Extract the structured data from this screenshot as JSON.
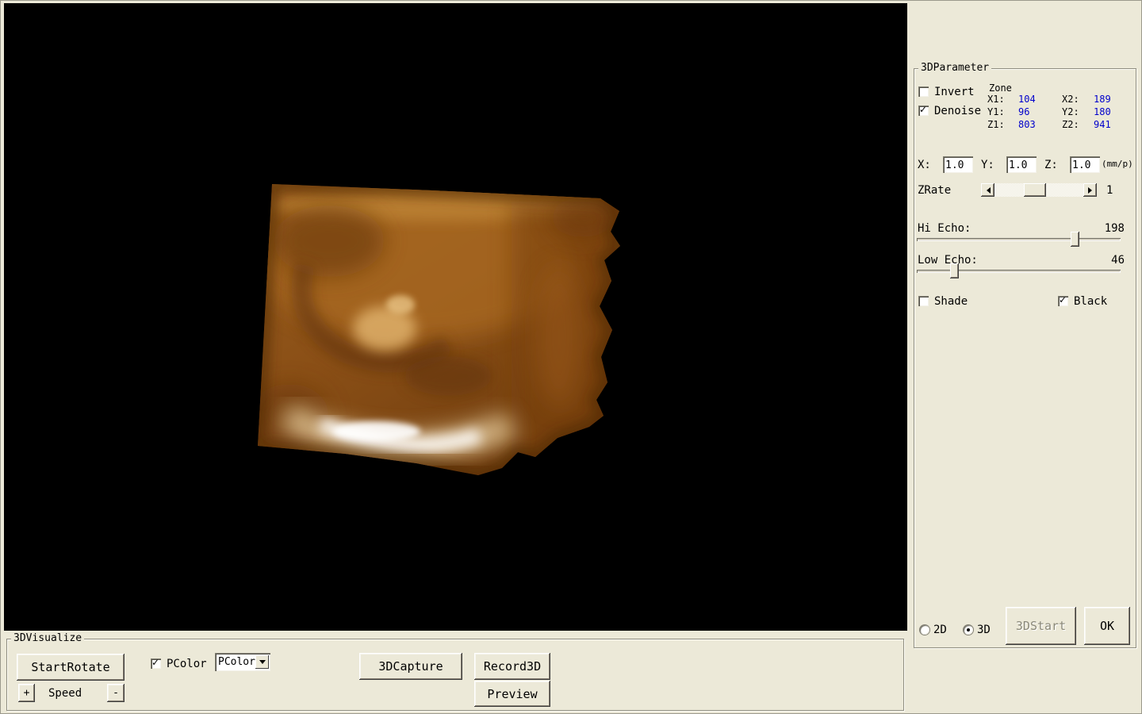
{
  "parameter_panel": {
    "title": "3DParameter",
    "invert": "Invert",
    "denoise": "Denoise",
    "zone": {
      "title": "Zone",
      "x1_label": "X1:",
      "x1_value": "104",
      "x2_label": "X2:",
      "x2_value": "189",
      "y1_label": "Y1:",
      "y1_value": "96",
      "y2_label": "Y2:",
      "y2_value": "180",
      "z1_label": "Z1:",
      "z1_value": "803",
      "z2_label": "Z2:",
      "z2_value": "941"
    },
    "scale": {
      "x_label": "X:",
      "x_value": "1.0",
      "y_label": "Y:",
      "y_value": "1.0",
      "z_label": "Z:",
      "z_value": "1.0",
      "unit": "(mm/p)"
    },
    "zrate_label": "ZRate",
    "zrate_value": "1",
    "hi_echo_label": "Hi Echo:",
    "hi_echo_value": "198",
    "low_echo_label": "Low Echo:",
    "low_echo_value": "46",
    "shade": "Shade",
    "black": "Black",
    "mode_2d": "2D",
    "mode_3d": "3D",
    "start_button": "3DStart",
    "ok_button": "OK"
  },
  "visualize_panel": {
    "title": "3DVisualize",
    "start_rotate": "StartRotate",
    "pcolor_check": "PColor",
    "pcolor_select": "PColor",
    "capture": "3DCapture",
    "record": "Record3D",
    "preview": "Preview",
    "speed_plus": "+",
    "speed_label": "Speed",
    "speed_minus": "-"
  },
  "colors": {
    "panel_bg": "#ece9d8",
    "value_blue": "#0000cc",
    "viewport_bg": "#000000"
  }
}
